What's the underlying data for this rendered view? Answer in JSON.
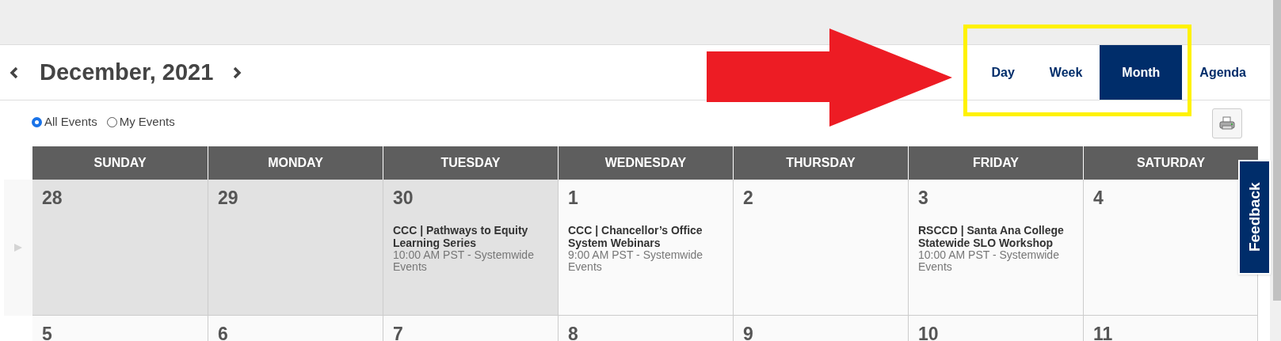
{
  "header": {
    "title": "December, 2021"
  },
  "views": [
    {
      "label": "Day",
      "selected": false
    },
    {
      "label": "Week",
      "selected": false
    },
    {
      "label": "Month",
      "selected": true
    },
    {
      "label": "Agenda",
      "selected": false
    }
  ],
  "filters": [
    {
      "label": "All Events",
      "selected": true
    },
    {
      "label": "My Events",
      "selected": false
    }
  ],
  "weekdays": [
    "SUNDAY",
    "MONDAY",
    "TUESDAY",
    "WEDNESDAY",
    "THURSDAY",
    "FRIDAY",
    "SATURDAY"
  ],
  "weeks": [
    {
      "days": [
        {
          "day": "28",
          "past": true
        },
        {
          "day": "29",
          "past": true
        },
        {
          "day": "30",
          "past": true,
          "events": [
            {
              "title": "CCC | Pathways to Equity Learning Series",
              "time": "10:00 AM PST - Systemwide Events"
            }
          ]
        },
        {
          "day": "1",
          "past": false,
          "events": [
            {
              "title": "CCC | Chancellor’s Office System Webinars",
              "time": "9:00 AM PST - Systemwide Events"
            }
          ]
        },
        {
          "day": "2",
          "past": false
        },
        {
          "day": "3",
          "past": false,
          "events": [
            {
              "title": "RSCCD | Santa Ana College Statewide SLO Workshop",
              "time": "10:00 AM PST - Systemwide Events"
            }
          ]
        },
        {
          "day": "4",
          "past": false
        }
      ]
    },
    {
      "days": [
        {
          "day": "5",
          "past": false
        },
        {
          "day": "6",
          "past": false
        },
        {
          "day": "7",
          "past": false
        },
        {
          "day": "8",
          "past": false
        },
        {
          "day": "9",
          "past": false
        },
        {
          "day": "10",
          "past": false
        },
        {
          "day": "11",
          "past": false
        }
      ]
    }
  ],
  "feedback": {
    "label": "Feedback"
  }
}
